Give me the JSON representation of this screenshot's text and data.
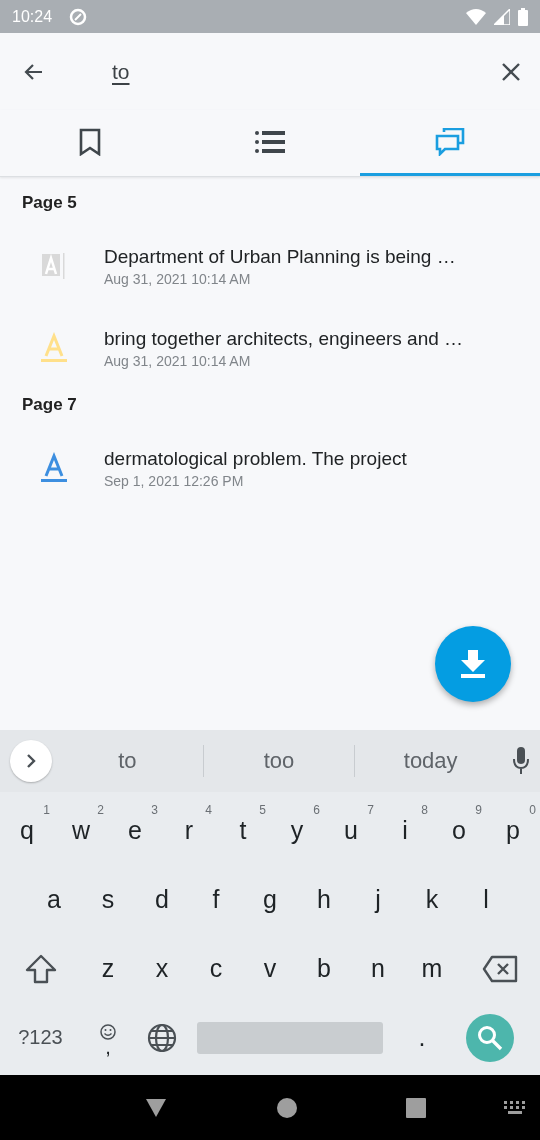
{
  "status_bar": {
    "time": "10:24"
  },
  "search": {
    "value": "to"
  },
  "tabs": [
    {
      "kind": "bookmarks",
      "selected": false
    },
    {
      "kind": "outline",
      "selected": false
    },
    {
      "kind": "annotations",
      "selected": true
    }
  ],
  "groups": [
    {
      "title": "Page 5",
      "items": [
        {
          "kind": "textbox",
          "color": "#d9d9d9",
          "text": "Department of Urban Planning is being …",
          "date": "Aug 31, 2021 10:14 AM"
        },
        {
          "kind": "highlight",
          "color": "#ffe08a",
          "text": "bring together architects, engineers and …",
          "date": "Aug 31, 2021 10:14 AM"
        }
      ]
    },
    {
      "title": "Page 7",
      "items": [
        {
          "kind": "underline",
          "color": "#3d8fe0",
          "text": "dermatological problem. The project",
          "date": "Sep 1, 2021 12:26 PM"
        }
      ]
    }
  ],
  "suggestions": [
    "to",
    "too",
    "today"
  ],
  "keyboard": {
    "row1": [
      {
        "label": "q",
        "hint": "1"
      },
      {
        "label": "w",
        "hint": "2"
      },
      {
        "label": "e",
        "hint": "3"
      },
      {
        "label": "r",
        "hint": "4"
      },
      {
        "label": "t",
        "hint": "5"
      },
      {
        "label": "y",
        "hint": "6"
      },
      {
        "label": "u",
        "hint": "7"
      },
      {
        "label": "i",
        "hint": "8"
      },
      {
        "label": "o",
        "hint": "9"
      },
      {
        "label": "p",
        "hint": "0"
      }
    ],
    "row2": [
      "a",
      "s",
      "d",
      "f",
      "g",
      "h",
      "j",
      "k",
      "l"
    ],
    "row3": [
      "z",
      "x",
      "c",
      "v",
      "b",
      "n",
      "m"
    ],
    "symbols_key": "?123",
    "comma_key": ",",
    "period_key": "."
  }
}
